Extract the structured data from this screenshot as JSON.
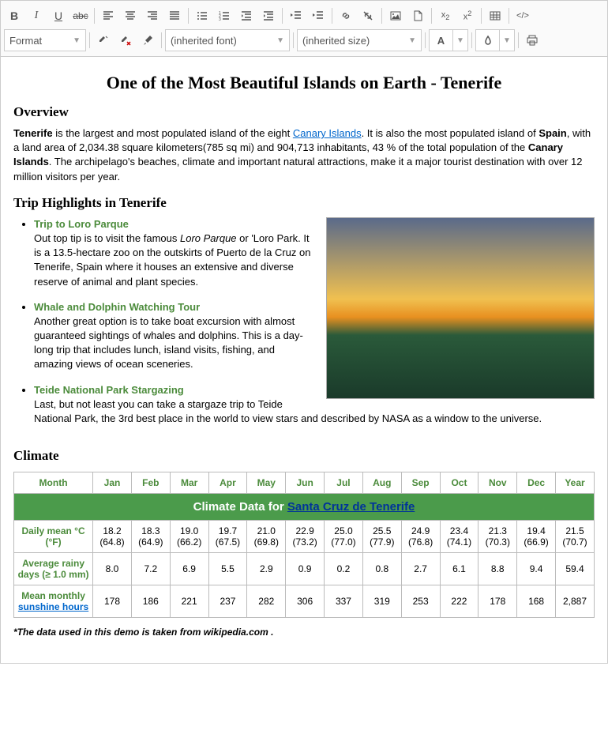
{
  "toolbar": {
    "format_label": "Format",
    "font_label": "(inherited font)",
    "size_label": "(inherited size)",
    "a_label": "A"
  },
  "title": "One of the Most Beautiful Islands on Earth - Tenerife",
  "overview": {
    "heading": "Overview",
    "p_pre_bold1": "Tenerife",
    "p_mid1": " is the largest and most populated island of the eight ",
    "link1": "Canary Islands",
    "p_mid2": ". It is also the most populated island of ",
    "p_bold2": "Spain",
    "p_mid3": ", with a land area of 2,034.38 square kilometers(785 sq mi) and 904,713 inhabitants, 43 % of the total population of the ",
    "p_bold3": "Canary Islands",
    "p_end": ". The archipelago's beaches, climate and important natural attractions, make it a major tourist destination with over 12 million visitors per year."
  },
  "highlights": {
    "heading": "Trip Highlights in Tenerife",
    "items": [
      {
        "title": "Trip to Loro Parque",
        "pre": "Out top tip is to visit the famous ",
        "em": "Loro Parque",
        "post": " or 'Loro Park. It is a 13.5-hectare zoo on the outskirts of Puerto de la Cruz on Tenerife, Spain where it houses an extensive and diverse reserve of animal and plant species."
      },
      {
        "title": "Whale and Dolphin Watching Tour",
        "pre": "Another great option is to take boat excursion with almost guaranteed sightings of whales and dolphins. This is a day-long trip that includes lunch, island visits, fishing, and amazing views of ocean sceneries.",
        "em": "",
        "post": ""
      },
      {
        "title": "Teide National Park Stargazing",
        "pre": "Last, but not least you can take a stargaze trip to Teide National Park, the 3rd best place in the world to view stars and described by NASA as a window to the universe.",
        "em": "",
        "post": ""
      }
    ]
  },
  "climate": {
    "heading": "Climate",
    "caption_pre": "Climate Data for ",
    "caption_link": "Santa Cruz de Tenerife",
    "months": [
      "Month",
      "Jan",
      "Feb",
      "Mar",
      "Apr",
      "May",
      "Jun",
      "Jul",
      "Aug",
      "Sep",
      "Oct",
      "Nov",
      "Dec",
      "Year"
    ],
    "rows": [
      {
        "label": "Daily mean °C (°F)",
        "cells": [
          "18.2 (64.8)",
          "18.3 (64.9)",
          "19.0 (66.2)",
          "19.7 (67.5)",
          "21.0 (69.8)",
          "22.9 (73.2)",
          "25.0 (77.0)",
          "25.5 (77.9)",
          "24.9 (76.8)",
          "23.4 (74.1)",
          "21.3 (70.3)",
          "19.4 (66.9)",
          "21.5 (70.7)"
        ],
        "link": false
      },
      {
        "label": "Average rainy days (≥ 1.0 mm)",
        "cells": [
          "8.0",
          "7.2",
          "6.9",
          "5.5",
          "2.9",
          "0.9",
          "0.2",
          "0.8",
          "2.7",
          "6.1",
          "8.8",
          "9.4",
          "59.4"
        ],
        "link": false
      },
      {
        "label_pre": "Mean monthly ",
        "label_link": "sunshine hours",
        "cells": [
          "178",
          "186",
          "221",
          "237",
          "282",
          "306",
          "337",
          "319",
          "253",
          "222",
          "178",
          "168",
          "2,887"
        ],
        "link": true
      }
    ],
    "footnote": "*The data used in this demo is taken from wikipedia.com ."
  }
}
